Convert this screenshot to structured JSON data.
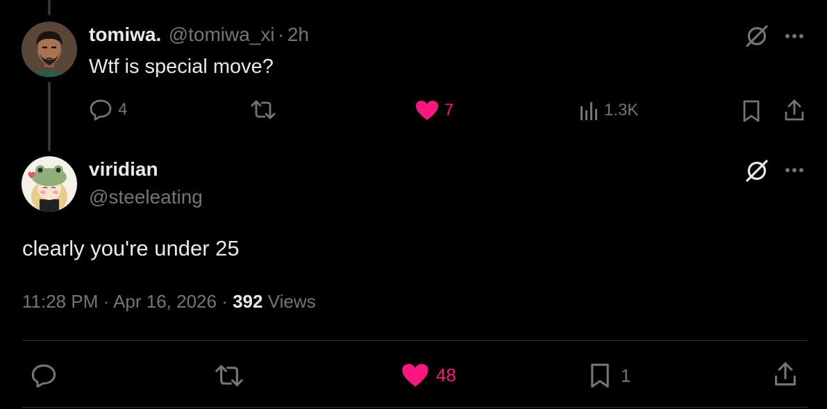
{
  "reply_parent": {
    "display_name": "tomiwa.",
    "handle": "@tomiwa_xi",
    "separator": "·",
    "time_ago": "2h",
    "text": "Wtf is special move?",
    "actions": {
      "replies": "4",
      "likes": "7",
      "views": "1.3K"
    }
  },
  "main_post": {
    "display_name": "viridian",
    "handle": "@steeleating",
    "text": "clearly you're under 25",
    "time": "11:28 PM",
    "sep1": "·",
    "date": "Apr 16, 2026",
    "sep2": "·",
    "views_count": "392",
    "views_label": "Views",
    "actions": {
      "likes": "48",
      "bookmarks": "1"
    }
  },
  "colors": {
    "background": "#000000",
    "text_primary": "#e7e9ea",
    "text_secondary": "#71767b",
    "like_pink": "#f91880",
    "divider": "#2f3336"
  },
  "icons": [
    "reply-icon",
    "repost-icon",
    "like-icon",
    "views-icon",
    "bookmark-icon",
    "share-icon",
    "grok-icon",
    "more-icon"
  ]
}
